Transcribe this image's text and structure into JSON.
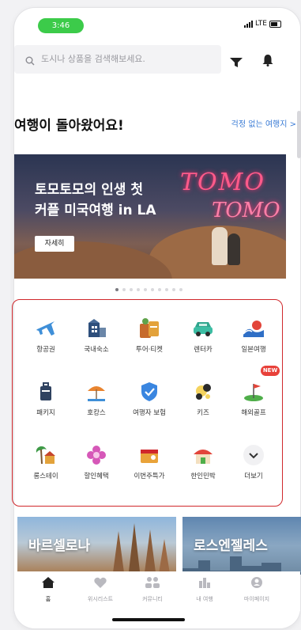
{
  "status_bar": {
    "time": "3:46",
    "network": "LTE"
  },
  "search": {
    "placeholder": "도시나 상품을 검색해보세요."
  },
  "headline": {
    "title": "여행이 돌아왔어요!",
    "link": "걱정 없는 여행지 >"
  },
  "banner": {
    "line1": "토모토모의 인생 첫",
    "line2": "커플 미국여행 in LA",
    "button": "자세히",
    "neon1": "TOMO",
    "neon2": "TOMO",
    "page_count": 10,
    "active_page": 1
  },
  "categories": [
    {
      "label": "항공권",
      "icon": "airplane-icon"
    },
    {
      "label": "국내숙소",
      "icon": "hotel-icon"
    },
    {
      "label": "투어·티켓",
      "icon": "tour-ticket-icon"
    },
    {
      "label": "렌터카",
      "icon": "rental-car-icon"
    },
    {
      "label": "일본여행",
      "icon": "japan-wave-icon"
    },
    {
      "label": "패키지",
      "icon": "suitcase-icon"
    },
    {
      "label": "호캉스",
      "icon": "beach-umbrella-icon"
    },
    {
      "label": "여행자 보험",
      "icon": "insurance-shield-icon"
    },
    {
      "label": "키즈",
      "icon": "kids-icon"
    },
    {
      "label": "해외골프",
      "icon": "golf-icon"
    },
    {
      "label": "롱스테이",
      "icon": "palm-house-icon"
    },
    {
      "label": "할인혜택",
      "icon": "discount-flower-icon"
    },
    {
      "label": "이번주특가",
      "icon": "weekly-deal-icon"
    },
    {
      "label": "한인민박",
      "icon": "guesthouse-icon"
    },
    {
      "label": "더보기",
      "icon": "chevron-down-icon"
    }
  ],
  "new_badge": "NEW",
  "cities": [
    {
      "name": "바르셀로나"
    },
    {
      "name": "로스엔젤레스"
    }
  ],
  "nav": [
    {
      "label": "홈",
      "icon": "home-icon"
    },
    {
      "label": "위시리스트",
      "icon": "heart-icon"
    },
    {
      "label": "커뮤니티",
      "icon": "community-icon"
    },
    {
      "label": "내 여행",
      "icon": "my-trip-icon"
    },
    {
      "label": "마이페이지",
      "icon": "profile-icon"
    }
  ],
  "colors": {
    "accent": "#3a7bd5",
    "highlight_border": "#d0282c",
    "status_pill": "#3ccb4a",
    "badge": "#e8413a"
  }
}
